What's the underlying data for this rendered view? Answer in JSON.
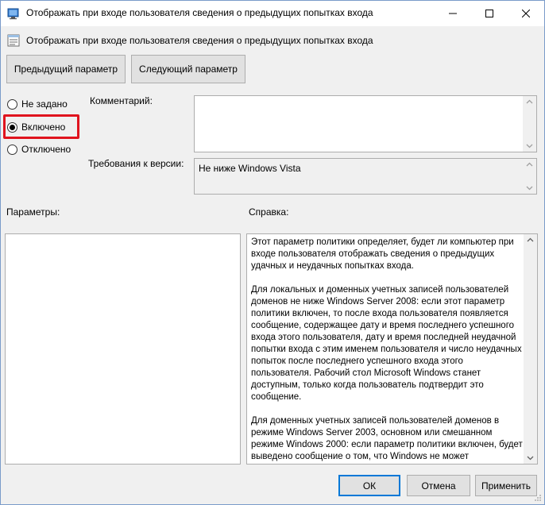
{
  "window": {
    "title": "Отображать при входе пользователя сведения о предыдущих попытках входа"
  },
  "header": {
    "policy_name": "Отображать при входе пользователя сведения о предыдущих попытках входа"
  },
  "nav": {
    "prev_label": "Предыдущий параметр",
    "next_label": "Следующий параметр"
  },
  "state": {
    "options": [
      {
        "label": "Не задано",
        "checked": false
      },
      {
        "label": "Включено",
        "checked": true
      },
      {
        "label": "Отключено",
        "checked": false
      }
    ],
    "highlight_color": "#e0141e"
  },
  "comment": {
    "label": "Комментарий:",
    "value": ""
  },
  "version": {
    "label": "Требования к версии:",
    "value": "Не ниже Windows Vista"
  },
  "params": {
    "label": "Параметры:"
  },
  "help": {
    "label": "Справка:",
    "paragraphs": [
      "Этот параметр политики определяет, будет ли компьютер при входе пользователя отображать сведения о предыдущих удачных и неудачных попытках входа.",
      "Для локальных и доменных учетных записей пользователей доменов не ниже Windows Server 2008: если этот параметр политики включен, то после входа пользователя появляется сообщение, содержащее дату и время последнего успешного входа этого пользователя, дату и время последней неудачной попытки входа с этим именем пользователя и число неудачных попыток после последнего успешного входа этого пользователя. Рабочий стол Microsoft Windows станет доступным, только когда пользователь подтвердит это сообщение.",
      "Для доменных учетных записей пользователей доменов в режиме Windows Server 2003, основном или смешанном режиме Windows 2000: если параметр политики включен, будет выведено сообщение о том, что Windows не может"
    ]
  },
  "footer": {
    "ok_label": "ОК",
    "cancel_label": "Отмена",
    "apply_label": "Применить"
  },
  "colors": {
    "accent": "#0078d7",
    "window_bg": "#f0f0f0"
  }
}
